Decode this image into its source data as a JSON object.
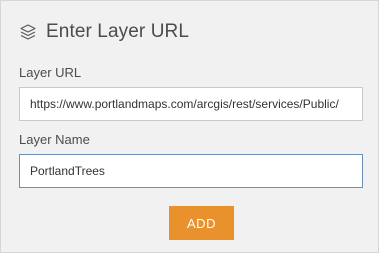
{
  "header": {
    "icon": "layers-icon",
    "title": "Enter Layer URL"
  },
  "layer_url": {
    "label": "Layer URL",
    "value": "https://www.portlandmaps.com/arcgis/rest/services/Public/"
  },
  "layer_name": {
    "label": "Layer Name",
    "value": "PortlandTrees"
  },
  "actions": {
    "add_label": "ADD"
  },
  "colors": {
    "accent": "#e8912d",
    "panel_background": "#f1f1f1",
    "focus_border": "#6b8fb9",
    "text": "#4c4c4c"
  }
}
